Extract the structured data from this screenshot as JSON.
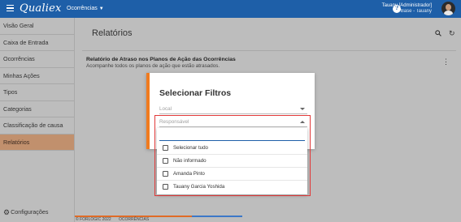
{
  "topbar": {
    "logo": "Qualiex",
    "module": "Ocorrências",
    "user_name": "Tauany [Administrador]",
    "user_sub": "Base - Tauany"
  },
  "sidebar": {
    "items": [
      {
        "label": "Visão Geral"
      },
      {
        "label": "Caixa de Entrada"
      },
      {
        "label": "Ocorrências"
      },
      {
        "label": "Minhas Ações"
      },
      {
        "label": "Tipos"
      },
      {
        "label": "Categorias"
      },
      {
        "label": "Classificação de causa"
      },
      {
        "label": "Relatórios"
      }
    ],
    "active_index": 7,
    "config_label": "Configurações"
  },
  "page": {
    "title": "Relatórios",
    "report_title": "Relatório de Atraso nos Planos de Ação das Ocorrências",
    "report_subtitle": "Acompanhe todos os planos de ação que estão atrasados."
  },
  "dialog": {
    "title": "Selecionar Filtros",
    "field_local": "Local",
    "field_responsavel": "Responsável",
    "options": [
      {
        "label": "Selecionar tudo",
        "checked": false
      },
      {
        "label": "Não informado",
        "checked": false
      },
      {
        "label": "Amanda Pinto",
        "checked": false
      },
      {
        "label": "Tauany Garcia Yoshida",
        "checked": false
      }
    ]
  },
  "footer": {
    "copyright": "© FORLOGIC 2022",
    "module_tag": "OCORRÊNCIAS"
  },
  "colors": {
    "topbar": "#1e5fa8",
    "accent": "#f07b1f",
    "active_nav": "#c1906d",
    "highlight": "#e23a3a"
  }
}
